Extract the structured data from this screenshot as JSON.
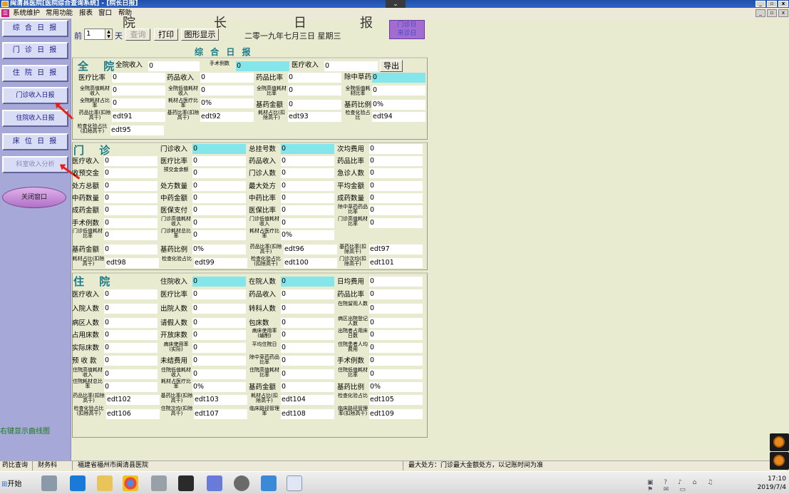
{
  "window": {
    "title": "闽清县医院[医院综合查询系统] - [院长日报]",
    "dropdown_icon": "chevron-down"
  },
  "menu": {
    "items": [
      "系统维护",
      "常用功能",
      "报表",
      "窗口",
      "帮助"
    ]
  },
  "sidebar": {
    "buttons": [
      "综 合 日 报",
      "门 诊 日 报",
      "住 院 日 报",
      "门诊收入日报",
      "住院收入日报",
      "床 位 日 报",
      "科室收入分析"
    ],
    "close": "关闭窗口",
    "hint": "右键显示曲线图"
  },
  "header": {
    "heading_left": "院",
    "heading_mid1": "长",
    "heading_mid2": "日",
    "heading_right": "报",
    "prefix": "前",
    "days_value": "1",
    "days_unit": "天",
    "query": "查询",
    "print": "打印",
    "chart": "图形显示",
    "date": "二零一九年七月三日",
    "weekday": "星期三",
    "purple_line1": "门诊日",
    "purple_line2": "来诊日"
  },
  "section_title": "综 合 日 报",
  "groups": {
    "whole": "全 院",
    "outpatient": "门 诊",
    "inpatient": "住 院"
  },
  "export": "导出",
  "whole_fields": [
    {
      "label": "全院收入",
      "value": "0"
    },
    {
      "label": "手术例数",
      "value": "0"
    },
    {
      "label": "医疗收入",
      "value": "0"
    },
    {
      "label": "医疗比率",
      "value": "0"
    },
    {
      "label": "药品收入",
      "value": "0"
    },
    {
      "label": "药品比率",
      "value": "0"
    },
    {
      "label": "除中草药药品比率",
      "value": "0"
    },
    {
      "label": "全院高值耗材收入",
      "value": "0"
    },
    {
      "label": "全院低值耗材收入",
      "value": "0"
    },
    {
      "label": "全院高值耗材比率",
      "value": "0"
    },
    {
      "label": "全院低值耗材比率",
      "value": "0"
    },
    {
      "label": "全院耗材占比率",
      "value": "0"
    },
    {
      "label": "耗材占医疗比率",
      "value": "0%"
    },
    {
      "label": "基药金额",
      "value": "0"
    },
    {
      "label": "基药比例",
      "value": "0%"
    },
    {
      "label": "药品比率(扣除高干)",
      "value": "edt91"
    },
    {
      "label": "基药比率(扣除高干)",
      "value": "edt92"
    },
    {
      "label": "耗材占比(扣除高干)",
      "value": "edt93"
    },
    {
      "label": "检查化验占比",
      "value": "edt94"
    },
    {
      "label": "检查化验占比(扣除高干)",
      "value": "edt95"
    }
  ],
  "outpatient_fields": [
    {
      "label": "门诊收入",
      "value": "0"
    },
    {
      "label": "总挂号数",
      "value": "0"
    },
    {
      "label": "次均费用",
      "value": "0"
    },
    {
      "label": "医疗收入",
      "value": "0"
    },
    {
      "label": "医疗比率",
      "value": "0"
    },
    {
      "label": "药品收入",
      "value": "0"
    },
    {
      "label": "药品比率",
      "value": "0"
    },
    {
      "label": "收预交金",
      "value": "0"
    },
    {
      "label": "预交金余额",
      "value": "0"
    },
    {
      "label": "门诊人数",
      "value": "0"
    },
    {
      "label": "急诊人数",
      "value": "0"
    },
    {
      "label": "处方总额",
      "value": "0"
    },
    {
      "label": "处方数量",
      "value": "0"
    },
    {
      "label": "最大处方",
      "value": "0"
    },
    {
      "label": "平均金额",
      "value": "0"
    },
    {
      "label": "中药数量",
      "value": "0"
    },
    {
      "label": "中药金额",
      "value": "0"
    },
    {
      "label": "中药比率",
      "value": "0"
    },
    {
      "label": "成药数量",
      "value": "0"
    },
    {
      "label": "成药金额",
      "value": "0"
    },
    {
      "label": "医保支付",
      "value": "0"
    },
    {
      "label": "医保比率",
      "value": "0"
    },
    {
      "label": "除中草药药品比率",
      "value": "0"
    },
    {
      "label": "手术例数",
      "value": "0"
    },
    {
      "label": "门诊高值耗材收入",
      "value": "0"
    },
    {
      "label": "门诊低值耗材收入",
      "value": "0"
    },
    {
      "label": "门诊高值耗材比率",
      "value": "0"
    },
    {
      "label": "门诊低值耗材比率",
      "value": "0"
    },
    {
      "label": "门诊耗材总比率",
      "value": "0"
    },
    {
      "label": "耗材占医疗比率",
      "value": "0%"
    },
    {
      "label": "基药金额",
      "value": "0"
    },
    {
      "label": "基药比例",
      "value": "0%"
    },
    {
      "label": "药品比率(扣除高干)",
      "value": "edt96"
    },
    {
      "label": "基药比率(扣除高干)",
      "value": "edt97"
    },
    {
      "label": "耗材占比(扣除高干)",
      "value": "edt98"
    },
    {
      "label": "检查化验占比",
      "value": "edt99"
    },
    {
      "label": "检查化验占比(扣除高干)",
      "value": "edt100"
    },
    {
      "label": "门诊次均(扣除高干)",
      "value": "edt101"
    }
  ],
  "inpatient_fields": [
    {
      "label": "住院收入",
      "value": "0"
    },
    {
      "label": "在院人数",
      "value": "0"
    },
    {
      "label": "日均费用",
      "value": "0"
    },
    {
      "label": "医疗收入",
      "value": "0"
    },
    {
      "label": "医疗比率",
      "value": "0"
    },
    {
      "label": "药品收入",
      "value": "0"
    },
    {
      "label": "药品比率",
      "value": "0"
    },
    {
      "label": "入院人数",
      "value": "0"
    },
    {
      "label": "出院人数",
      "value": "0"
    },
    {
      "label": "转科人数",
      "value": "0"
    },
    {
      "label": "在院留观人数",
      "value": "0"
    },
    {
      "label": "病区人数",
      "value": "0"
    },
    {
      "label": "请假人数",
      "value": "0"
    },
    {
      "label": "包床数",
      "value": "0"
    },
    {
      "label": "病区出院登记人数",
      "value": "0"
    },
    {
      "label": "占用床数",
      "value": "0"
    },
    {
      "label": "开放床数",
      "value": "0"
    },
    {
      "label": "病床使用率(编制)",
      "value": "0"
    },
    {
      "label": "出院者占用床日数",
      "value": "0"
    },
    {
      "label": "实际床数",
      "value": "0"
    },
    {
      "label": "病床使用率(实际)",
      "value": "0"
    },
    {
      "label": "平均住院日",
      "value": "0"
    },
    {
      "label": "住院患者人均费用",
      "value": "0"
    },
    {
      "label": "预 收 款",
      "value": "0"
    },
    {
      "label": "未结费用",
      "value": "0"
    },
    {
      "label": "除中草药药品比率",
      "value": "0"
    },
    {
      "label": "手术例数",
      "value": "0"
    },
    {
      "label": "住院高值耗材收入",
      "value": "0"
    },
    {
      "label": "住院低值耗材收入",
      "value": "0"
    },
    {
      "label": "住院高值耗材比率",
      "value": "0"
    },
    {
      "label": "住院低值耗材比率",
      "value": "0"
    },
    {
      "label": "住院耗材总比率",
      "value": "0"
    },
    {
      "label": "耗材占医疗比率",
      "value": "0%"
    },
    {
      "label": "基药金额",
      "value": "0"
    },
    {
      "label": "基药比例",
      "value": "0%"
    },
    {
      "label": "药品比率(扣除高干)",
      "value": "edt102"
    },
    {
      "label": "基药比率(扣除高干)",
      "value": "edt103"
    },
    {
      "label": "耗材占比(扣除高干)",
      "value": "edt104"
    },
    {
      "label": "检查化验占比",
      "value": "edt105"
    },
    {
      "label": "检查化验占比(扣除高干)",
      "value": "edt106"
    },
    {
      "label": "住院次均(扣除高干)",
      "value": "edt107"
    },
    {
      "label": "临床路径管理率",
      "value": "edt108"
    },
    {
      "label": "临床路径管理率(扣除高干)",
      "value": "edt109"
    }
  ],
  "status": {
    "cells": [
      "药比查询",
      "财务科",
      "福建省福州市闽清县医院",
      "最大处方：门诊最大金额处方，以记账时间为准"
    ]
  },
  "taskbar": {
    "start": "开始",
    "time": "17:10",
    "date": "2019/7/4"
  },
  "colors": {
    "accent": "#1a7a8a",
    "highlight": "#84e6ea",
    "sidebar": "#a6a8d8",
    "background": "#e8ebcf"
  }
}
